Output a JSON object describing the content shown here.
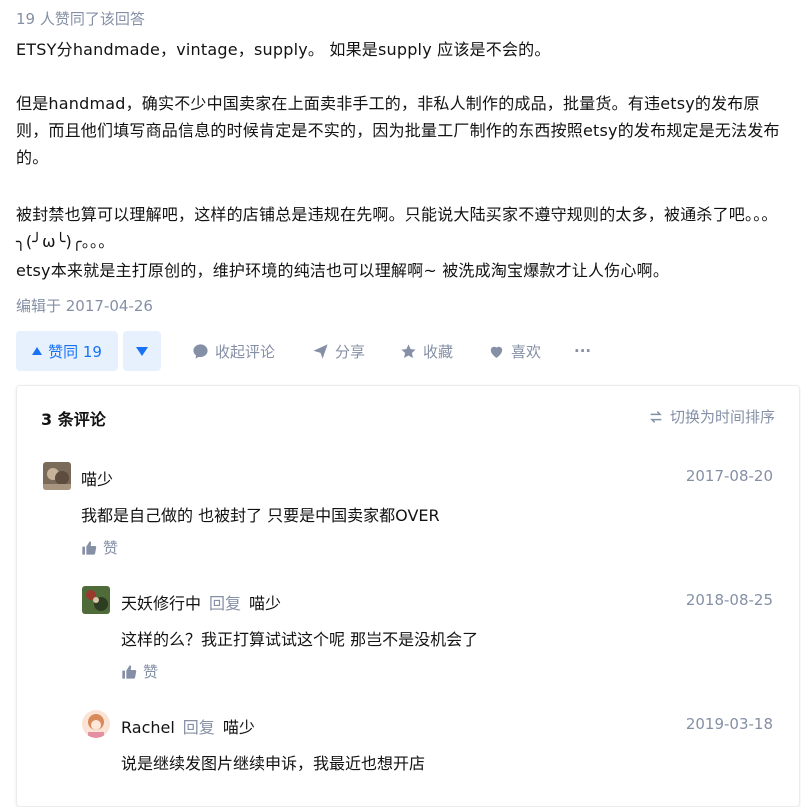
{
  "answer": {
    "voters": "19 人赞同了该回答",
    "paragraphs": [
      "ETSY分handmade，vintage，supply。 如果是supply 应该是不会的。",
      "但是handmad，确实不少中国卖家在上面卖非手工的，非私人制作的成品，批量货。有违etsy的发布原则，而且他们填写商品信息的时候肯定是不实的，因为批量工厂制作的东西按照etsy的发布规定是无法发布的。",
      "被封禁也算可以理解吧，这样的店铺总是违规在先啊。只能说大陆买家不遵守规则的太多，被通杀了吧。。。╮(╯ω╰)╭。。。",
      "etsy本来就是主打原创的，维护环境的纯洁也可以理解啊~ 被洗成淘宝爆款才让人伤心啊。"
    ],
    "edited": "编辑于 2017-04-26"
  },
  "actions": {
    "upvote": "赞同 19",
    "collapse_comments": "收起评论",
    "share": "分享",
    "collect": "收藏",
    "like": "喜欢",
    "more": "···"
  },
  "comments": {
    "title": "3 条评论",
    "sort_label": "切换为时间排序",
    "items": [
      {
        "author": "喵少",
        "date": "2017-08-20",
        "text": "我都是自己做的 也被封了 只要是中国卖家都OVER",
        "like": "赞"
      },
      {
        "author": "天妖修行中",
        "reply_word": "回复",
        "reply_to": "喵少",
        "date": "2018-08-25",
        "text": "这样的么？我正打算试试这个呢 那岂不是没机会了",
        "like": "赞"
      },
      {
        "author": "Rachel",
        "reply_word": "回复",
        "reply_to": "喵少",
        "date": "2019-03-18",
        "text": "说是继续发图片继续申诉，我最近也想开店"
      }
    ]
  },
  "colors": {
    "accent": "#1772f6",
    "muted": "#8590a6",
    "text": "#121212"
  },
  "icons": [
    "upvote-triangle-icon",
    "downvote-triangle-icon",
    "comment-bubble-icon",
    "share-paper-plane-icon",
    "star-icon",
    "heart-icon",
    "more-dots-icon",
    "sort-arrows-icon",
    "thumb-up-icon"
  ]
}
